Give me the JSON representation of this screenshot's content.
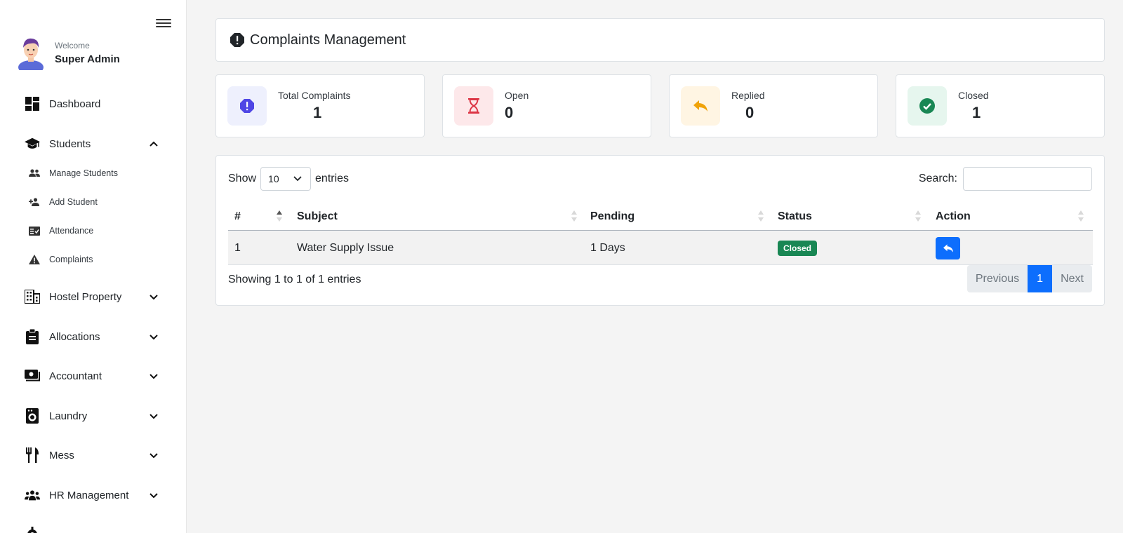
{
  "sidebar": {
    "welcome": "Welcome",
    "user_name": "Super Admin",
    "items": [
      {
        "label": "Dashboard",
        "icon": "dashboard-icon"
      },
      {
        "label": "Students",
        "icon": "graduation-cap-icon",
        "expanded": true
      },
      {
        "label": "Hostel Property",
        "icon": "building-icon"
      },
      {
        "label": "Allocations",
        "icon": "clipboard-icon"
      },
      {
        "label": "Accountant",
        "icon": "money-icon"
      },
      {
        "label": "Laundry",
        "icon": "washing-machine-icon"
      },
      {
        "label": "Mess",
        "icon": "utensils-icon"
      },
      {
        "label": "HR Management",
        "icon": "users-icon"
      }
    ],
    "students_sub": [
      {
        "label": "Manage Students",
        "icon": "users-icon"
      },
      {
        "label": "Add Student",
        "icon": "user-plus-icon"
      },
      {
        "label": "Attendance",
        "icon": "attendance-icon"
      },
      {
        "label": "Complaints",
        "icon": "warning-icon"
      }
    ]
  },
  "header": {
    "title": "Complaints Management",
    "icon": "octagon-exclamation-icon"
  },
  "stats": [
    {
      "label": "Total Complaints",
      "value": "1",
      "color": "#4f46e5",
      "bg": "#eef0fd"
    },
    {
      "label": "Open",
      "value": "0",
      "color": "#dc3545",
      "bg": "#fde8ea"
    },
    {
      "label": "Replied",
      "value": "0",
      "color": "#f0a30a",
      "bg": "#fff5e3"
    },
    {
      "label": "Closed",
      "value": "1",
      "color": "#198754",
      "bg": "#e6f6ee"
    }
  ],
  "table": {
    "show_label": "Show",
    "page_size": "10",
    "entries_label": "entries",
    "search_label": "Search:",
    "search_value": "",
    "columns": [
      "#",
      "Subject",
      "Pending",
      "Status",
      "Action"
    ],
    "rows": [
      {
        "num": "1",
        "subject": "Water Supply Issue",
        "pending": "1 Days",
        "status": "Closed"
      }
    ],
    "info": "Showing 1 to 1 of 1 entries",
    "pagination": {
      "previous": "Previous",
      "current": "1",
      "next": "Next"
    }
  },
  "colors": {
    "primary": "#0d6efd",
    "success": "#198754"
  }
}
